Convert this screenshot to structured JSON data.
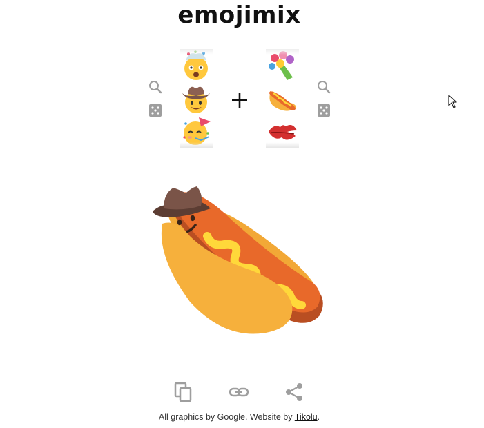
{
  "header": {
    "title": "emojimix"
  },
  "left_reel": {
    "items": [
      "exploding-head-emoji",
      "cowboy-hat-face-emoji",
      "partying-face-emoji"
    ],
    "selected": "cowboy-hat-face-emoji"
  },
  "right_reel": {
    "items": [
      "bouquet-emoji",
      "hot-dog-emoji",
      "kiss-mark-emoji"
    ],
    "selected": "hot-dog-emoji"
  },
  "result": {
    "emoji": "cowboy-hot-dog-mix"
  },
  "actions": [
    "copy-icon",
    "link-icon",
    "share-icon"
  ],
  "footer": {
    "prefix": "All graphics by Google. Website by ",
    "link_text": "Tikolu",
    "suffix": "."
  },
  "colors": {
    "bun": "#F6B03C",
    "sausage": "#E8692A",
    "sausage_shadow": "#B94E22",
    "mustard": "#FFD83A",
    "hat": "#7A5448",
    "face_yellow": "#FFC83D",
    "icon_gray": "#9e9e9e"
  }
}
